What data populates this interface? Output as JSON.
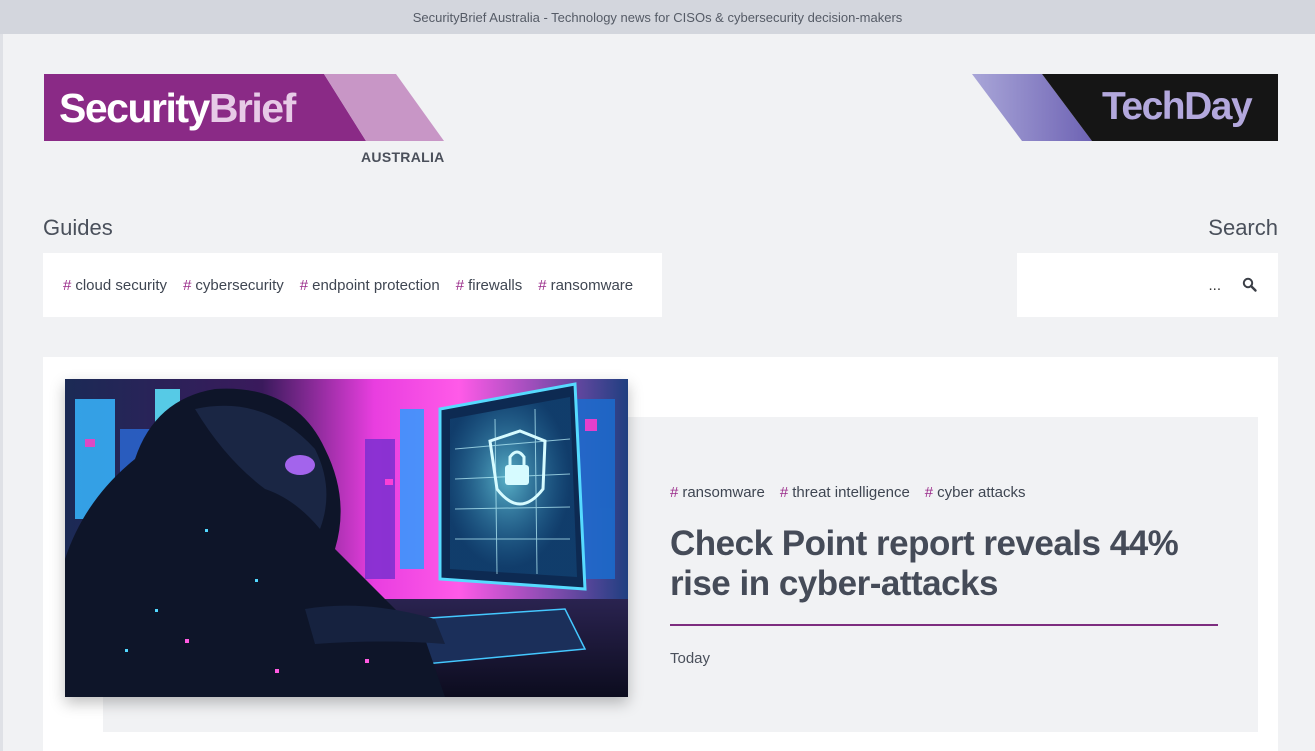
{
  "topbar": {
    "text": "SecurityBrief Australia - Technology news for CISOs & cybersecurity decision-makers"
  },
  "logo": {
    "part1": "Security",
    "part2": "Brief",
    "country": "AUSTRALIA",
    "colors": {
      "primary": "#8a2a86",
      "secondary": "#c896c6"
    }
  },
  "partner_logo": {
    "text": "TechDay",
    "colors": {
      "bg": "#151515",
      "accent": "#8d86c8",
      "text": "#b3a8dd"
    }
  },
  "guides": {
    "label": "Guides",
    "tags": [
      {
        "hash": "#",
        "label": "cloud security"
      },
      {
        "hash": "#",
        "label": "cybersecurity"
      },
      {
        "hash": "#",
        "label": "endpoint protection"
      },
      {
        "hash": "#",
        "label": "firewalls"
      },
      {
        "hash": "#",
        "label": "ransomware"
      }
    ]
  },
  "search": {
    "label": "Search",
    "value": "...",
    "icon": "search-icon"
  },
  "featured": {
    "image": "hooded-hacker-neon-illustration",
    "tags": [
      {
        "hash": "#",
        "label": "ransomware"
      },
      {
        "hash": "#",
        "label": "threat intelligence"
      },
      {
        "hash": "#",
        "label": "cyber attacks"
      }
    ],
    "headline": "Check Point report reveals 44% rise in cyber-attacks",
    "date": "Today",
    "accent_color": "#7d2d7f"
  }
}
